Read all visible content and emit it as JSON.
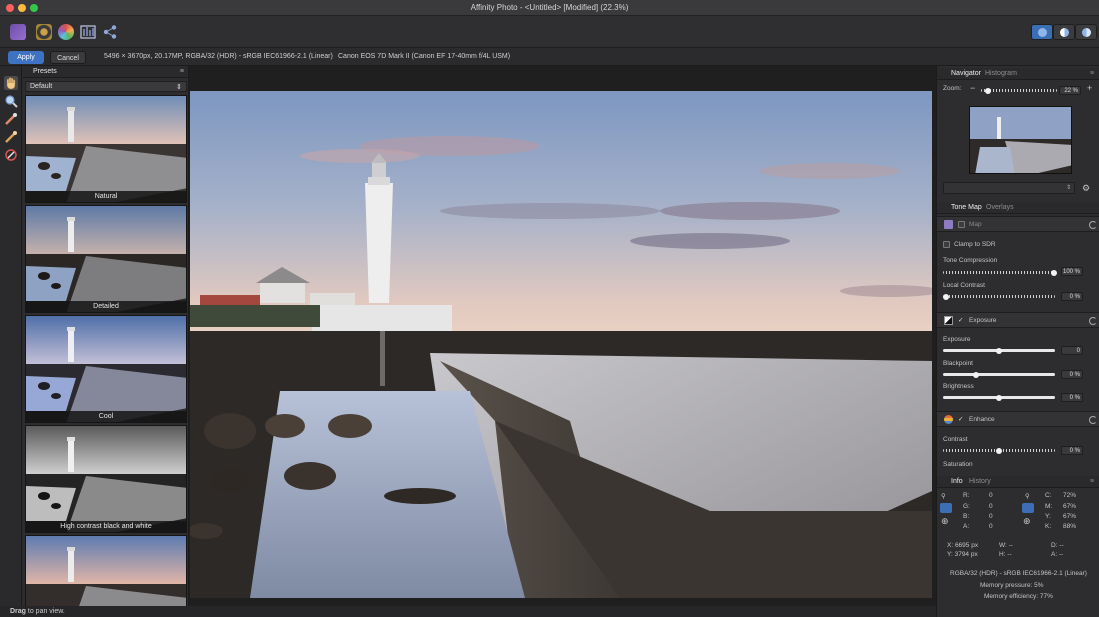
{
  "window": {
    "title": "Affinity Photo - <Untitled> [Modified] (22.3%)"
  },
  "context": {
    "apply_label": "Apply",
    "cancel_label": "Cancel",
    "image_info": "5496 × 3670px, 20.17MP, RGBA/32 (HDR) - sRGB IEC61966-2.1 (Linear)",
    "camera_info": "Canon EOS 7D Mark II (Canon EF 17-40mm f/4L USM)"
  },
  "presets": {
    "tab_label": "Presets",
    "category": "Default",
    "items": [
      {
        "label": "Natural"
      },
      {
        "label": "Detailed"
      },
      {
        "label": "Cool"
      },
      {
        "label": "High contrast black and white"
      },
      {
        "label": ""
      }
    ]
  },
  "navigator": {
    "tabs": [
      "Navigator",
      "Histogram"
    ],
    "zoom_label": "Zoom:",
    "zoom_value": "22 %",
    "zoom_minus": "−",
    "zoom_plus": "+"
  },
  "tonemap": {
    "tabs": [
      "Tone Map",
      "Overlays"
    ],
    "map_label": "Map",
    "clamp_label": "Clamp to SDR",
    "tone_compression": {
      "label": "Tone Compression",
      "value": "100 %",
      "level": 1.0
    },
    "local_contrast": {
      "label": "Local Contrast",
      "value": "0 %",
      "level": 0.0
    },
    "exposure_section": "Exposure",
    "exposure": {
      "label": "Exposure",
      "value": "0",
      "level": 0.5
    },
    "blackpoint": {
      "label": "Blackpoint",
      "value": "0 %",
      "level": 0.3
    },
    "brightness": {
      "label": "Brightness",
      "value": "0 %",
      "level": 0.5
    },
    "enhance_section": "Enhance",
    "contrast": {
      "label": "Contrast",
      "value": "0 %",
      "level": 0.5
    },
    "saturation": {
      "label": "Saturation"
    }
  },
  "info": {
    "tabs": [
      "Info",
      "History"
    ],
    "rgb": [
      {
        "k": "R:",
        "v": "0"
      },
      {
        "k": "G:",
        "v": "0"
      },
      {
        "k": "B:",
        "v": "0"
      },
      {
        "k": "A:",
        "v": "0"
      }
    ],
    "cmyk": [
      {
        "k": "C:",
        "v": "72%"
      },
      {
        "k": "M:",
        "v": "67%"
      },
      {
        "k": "Y:",
        "v": "67%"
      },
      {
        "k": "K:",
        "v": "88%"
      }
    ],
    "x": "X: 6695 px",
    "y": "Y: 3794 px",
    "w": "W: --",
    "h": "H: --",
    "d": "D: --",
    "a": "A: --",
    "format": "RGBA/32 (HDR) - sRGB IEC61966-2.1 (Linear)",
    "memory_pressure": "Memory pressure: 5%",
    "memory_efficiency": "Memory efficiency: 77%"
  },
  "status": {
    "bold": "Drag",
    "rest": " to pan view."
  }
}
